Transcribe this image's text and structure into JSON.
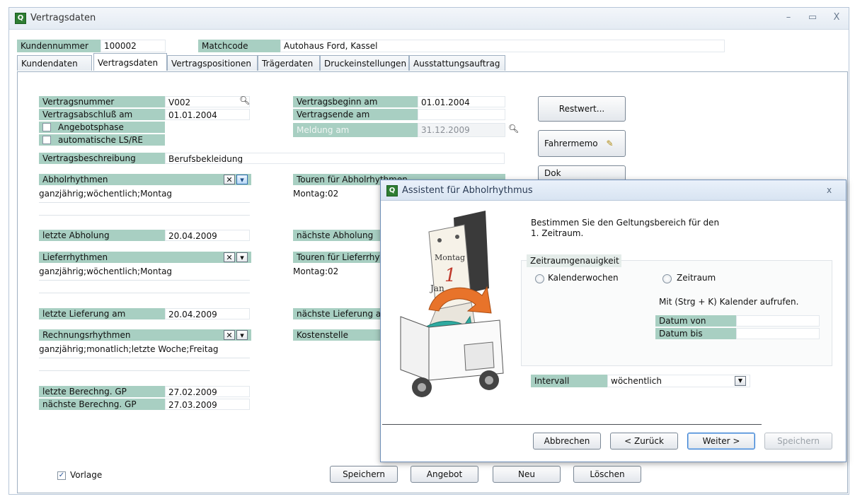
{
  "window": {
    "title": "Vertragsdaten",
    "minimize": "–",
    "maximize": "▭",
    "close": "X"
  },
  "header": {
    "kundennummer_label": "Kundennummer",
    "kundennummer_value": "100002",
    "matchcode_label": "Matchcode",
    "matchcode_value": "Autohaus Ford, Kassel"
  },
  "tabs": [
    {
      "label": "Kundendaten"
    },
    {
      "label": "Vertragsdaten"
    },
    {
      "label": "Vertragspositionen"
    },
    {
      "label": "Trägerdaten"
    },
    {
      "label": "Druckeinstellungen"
    },
    {
      "label": "Ausstattungsauftrag"
    }
  ],
  "form": {
    "vertragsnummer_label": "Vertragsnummer",
    "vertragsnummer_value": "V002",
    "vertragsabschluss_label": "Vertragsabschluß am",
    "vertragsabschluss_value": "01.01.2004",
    "angebotsphase_label": "Angebotsphase",
    "automatische_label": "automatische LS/RE",
    "vertragsbeschreibung_label": "Vertragsbeschreibung",
    "vertragsbeschreibung_value": "Berufsbekleidung",
    "vertragsbeginn_label": "Vertragsbeginn am",
    "vertragsbeginn_value": "01.01.2004",
    "vertragsende_label": "Vertragsende am",
    "meldung_label": "Meldung am",
    "meldung_value": "31.12.2009",
    "abholrhythmen_label": "Abholrhythmen",
    "abholrhythmen_value": "ganzjährig;wöchentlich;Montag",
    "touren_abhol_label": "Touren für Abholrhythmen",
    "touren_abhol_value": "Montag:02",
    "letzte_abholung_label": "letzte Abholung",
    "letzte_abholung_value": "20.04.2009",
    "naechste_abholung_label": "nächste Abholung",
    "lieferrhythmen_label": "Lieferrhythmen",
    "lieferrhythmen_value": "ganzjährig;wöchentlich;Montag",
    "touren_liefer_label": "Touren für Lieferrhythmen",
    "touren_liefer_value": "Montag:02",
    "letzte_lieferung_label": "letzte Lieferung am",
    "letzte_lieferung_value": "20.04.2009",
    "naechste_lieferung_label": "nächste Lieferung am",
    "rechnungsrhythmen_label": "Rechnungsrhythmen",
    "rechnungsrhythmen_value": "ganzjährig;monatlich;letzte Woche;Freitag",
    "kostenstelle_label": "Kostenstelle",
    "letzte_berechnung_label": "letzte Berechng. GP",
    "letzte_berechnung_value": "27.02.2009",
    "naechste_berechnung_label": "nächste Berechng. GP",
    "naechste_berechnung_value": "27.03.2009",
    "vorlage_label": "Vorlage"
  },
  "side_buttons": {
    "restwert": "Restwert...",
    "fahrermemo": "Fahrermemo",
    "third": "Dok"
  },
  "bottom_buttons": {
    "speichern": "Speichern",
    "angebot": "Angebot",
    "neu": "Neu",
    "loeschen": "Löschen"
  },
  "dialog": {
    "title": "Assistent für Abholrhythmus",
    "close": "x",
    "instruction_line1": "Bestimmen Sie den Geltungsbereich für den",
    "instruction_line2": "1. Zeitraum.",
    "group_title": "Zeitraumgenauigkeit",
    "radio_kalenderwochen": "Kalenderwochen",
    "radio_zeitraum": "Zeitraum",
    "hint": "Mit (Strg + K) Kalender aufrufen.",
    "datum_von_label": "Datum von",
    "datum_bis_label": "Datum bis",
    "intervall_label": "Intervall",
    "intervall_value": "wöchentlich",
    "calendar_month": "Montag",
    "calendar_day": "1",
    "calendar_bottom": "Jan",
    "btn_abbrechen": "Abbrechen",
    "btn_zurueck": "< Zurück",
    "btn_weiter": "Weiter >",
    "btn_speichern": "Speichern"
  }
}
